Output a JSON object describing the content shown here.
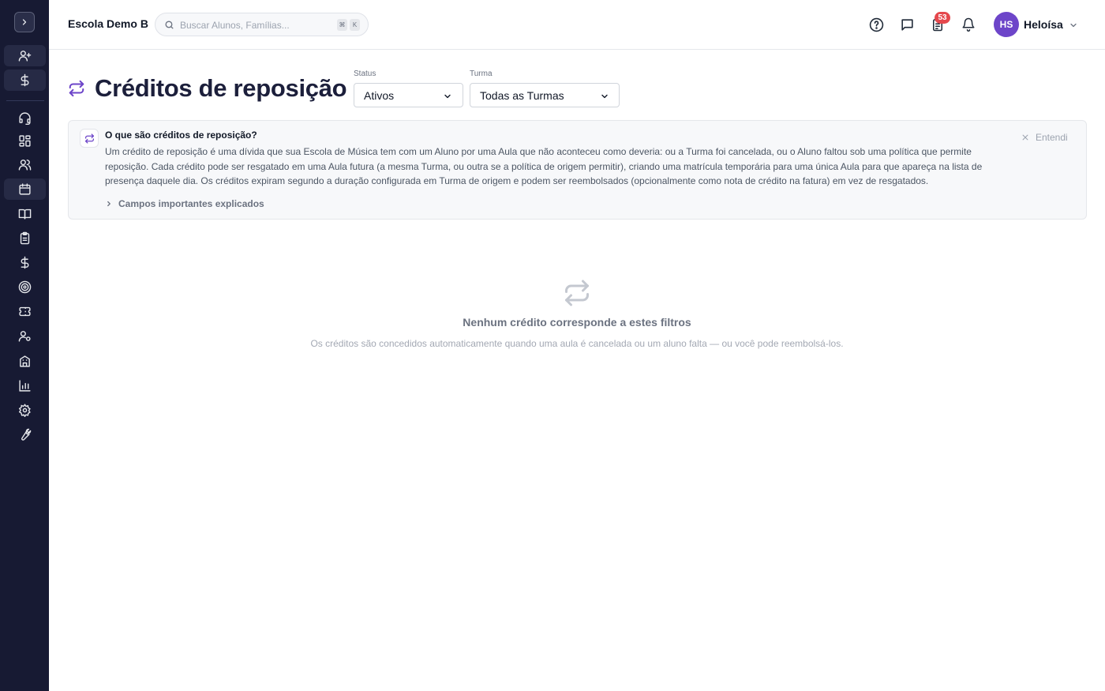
{
  "header": {
    "school_name": "Escola Demo B",
    "search_placeholder": "Buscar Alunos, Famílias...",
    "shortcut_keys": [
      "⌘",
      "K"
    ],
    "notification_count": "53",
    "user_initials": "HS",
    "user_name": "Heloísa"
  },
  "sidebar": {
    "items": [
      {
        "icon": "user-plus-icon"
      },
      {
        "icon": "dollar-icon"
      },
      {
        "icon": "headset-icon"
      },
      {
        "icon": "dashboard-icon"
      },
      {
        "icon": "users-icon"
      },
      {
        "icon": "calendar-icon"
      },
      {
        "icon": "book-open-icon"
      },
      {
        "icon": "clipboard-icon"
      },
      {
        "icon": "dollar-icon"
      },
      {
        "icon": "target-icon"
      },
      {
        "icon": "ticket-icon"
      },
      {
        "icon": "user-cog-icon"
      },
      {
        "icon": "building-icon"
      },
      {
        "icon": "bar-chart-icon"
      },
      {
        "icon": "gear-icon"
      },
      {
        "icon": "wrench-icon"
      }
    ]
  },
  "page": {
    "title": "Créditos de reposição",
    "filters": {
      "status_label": "Status",
      "status_value": "Ativos",
      "turma_label": "Turma",
      "turma_value": "Todas as Turmas"
    }
  },
  "info_box": {
    "title": "O que são créditos de reposição?",
    "body": "Um crédito de reposição é uma dívida que sua Escola de Música tem com um Aluno por uma Aula que não aconteceu como deveria: ou a Turma foi cancelada, ou o Aluno faltou sob uma política que permite reposição. Cada crédito pode ser resgatado em uma Aula futura (a mesma Turma, ou outra se a política de origem permitir), criando uma matrícula temporária para uma única Aula para que apareça na lista de presença daquele dia. Os créditos expiram segundo a duração configurada em Turma de origem e podem ser reembolsados (opcionalmente como nota de crédito na fatura) em vez de resgatados.",
    "expand_label": "Campos importantes explicados",
    "dismiss_label": "Entendi"
  },
  "empty_state": {
    "title": "Nenhum crédito corresponde a estes filtros",
    "subtitle": "Os créditos são concedidos automaticamente quando uma aula é cancelada ou um aluno falta — ou você pode reembolsá-los."
  },
  "colors": {
    "sidebar_bg": "#171a33",
    "accent": "#6d45c9",
    "badge": "#e5484d"
  }
}
